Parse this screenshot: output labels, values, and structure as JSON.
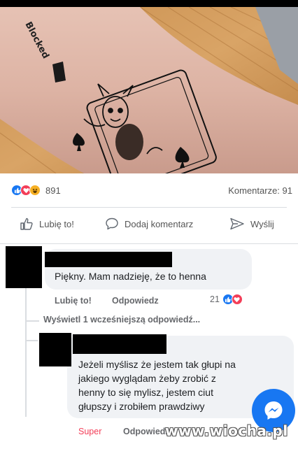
{
  "photo": {
    "tattoo_wrist_text": "Blocked"
  },
  "post": {
    "reactions": {
      "icons": [
        "like-icon",
        "love-icon",
        "haha-icon"
      ],
      "count": "891"
    },
    "comments_count": "Komentarze: 91",
    "actions": {
      "like": "Lubię to!",
      "comment": "Dodaj komentarz",
      "share": "Wyślij"
    }
  },
  "comment1": {
    "text": "Piękny. Mam nadzieję, że to henna",
    "like": "Lubię to!",
    "reply": "Odpowiedz",
    "reaction_count": "21"
  },
  "replies": {
    "more": "Wyświetl 1 wcześniejszą odpowiedź..."
  },
  "comment2": {
    "text_lines": [
      "Jeżeli myślisz że jestem tak głupi na",
      "jakiego wyglądam żeby zrobić z",
      "henny to się mylisz, jestem ciut",
      "głupszy i zrobiłem prawdziwy"
    ],
    "reaction_label": "Super",
    "reply": "Odpowiedz"
  },
  "watermark": {
    "site": "www.wiocha",
    "tld": ".pl"
  },
  "colors": {
    "facebook_blue": "#1877f2",
    "love_red": "#f33e58",
    "haha_yellow": "#f7b125",
    "bubble_grey": "#f0f2f5"
  }
}
